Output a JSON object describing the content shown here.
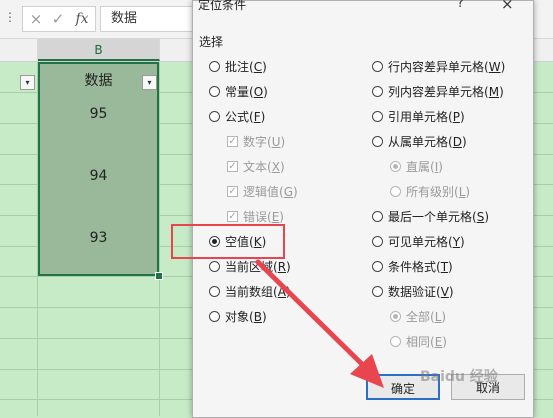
{
  "formula_bar": {
    "more": "⋮",
    "cancel_icon": "×",
    "confirm_icon": "✓",
    "fx_icon": "fx",
    "value": "数据"
  },
  "columns": {
    "b_label": "B"
  },
  "cells": {
    "header": "数据",
    "values": [
      "95",
      "94",
      "93"
    ]
  },
  "dialog": {
    "title": "定位条件",
    "help": "?",
    "close": "×",
    "section": "选择",
    "left_options": [
      {
        "text": "批注",
        "key": "C",
        "checked": false
      },
      {
        "text": "常量",
        "key": "O",
        "checked": false
      },
      {
        "text": "公式",
        "key": "F",
        "checked": false
      }
    ],
    "formula_sub": [
      {
        "text": "数字",
        "key": "U"
      },
      {
        "text": "文本",
        "key": "X"
      },
      {
        "text": "逻辑值",
        "key": "G"
      },
      {
        "text": "错误",
        "key": "E"
      }
    ],
    "left_options2": [
      {
        "text": "空值",
        "key": "K",
        "checked": true
      },
      {
        "text": "当前区域",
        "key": "R",
        "checked": false
      },
      {
        "text": "当前数组",
        "key": "A",
        "checked": false
      },
      {
        "text": "对象",
        "key": "B",
        "checked": false
      }
    ],
    "right_options": [
      {
        "text": "行内容差异单元格",
        "key": "W"
      },
      {
        "text": "列内容差异单元格",
        "key": "M"
      },
      {
        "text": "引用单元格",
        "key": "P"
      },
      {
        "text": "从属单元格",
        "key": "D"
      }
    ],
    "dependents_sub": [
      {
        "text": "直属",
        "key": "I",
        "checked": true
      },
      {
        "text": "所有级别",
        "key": "L",
        "checked": false
      }
    ],
    "right_options2": [
      {
        "text": "最后一个单元格",
        "key": "S"
      },
      {
        "text": "可见单元格",
        "key": "Y"
      },
      {
        "text": "条件格式",
        "key": "T"
      },
      {
        "text": "数据验证",
        "key": "V"
      }
    ],
    "validation_sub": [
      {
        "text": "全部",
        "key": "L",
        "checked": true
      },
      {
        "text": "相同",
        "key": "E",
        "checked": false
      }
    ],
    "ok": "确定",
    "cancel": "取消"
  },
  "watermark": "Baidu 经验",
  "colors": {
    "sheet_bg": "#c7ebc7",
    "selection": "#9ab99a",
    "accent_green": "#217346",
    "highlight_red": "#e8454f"
  }
}
